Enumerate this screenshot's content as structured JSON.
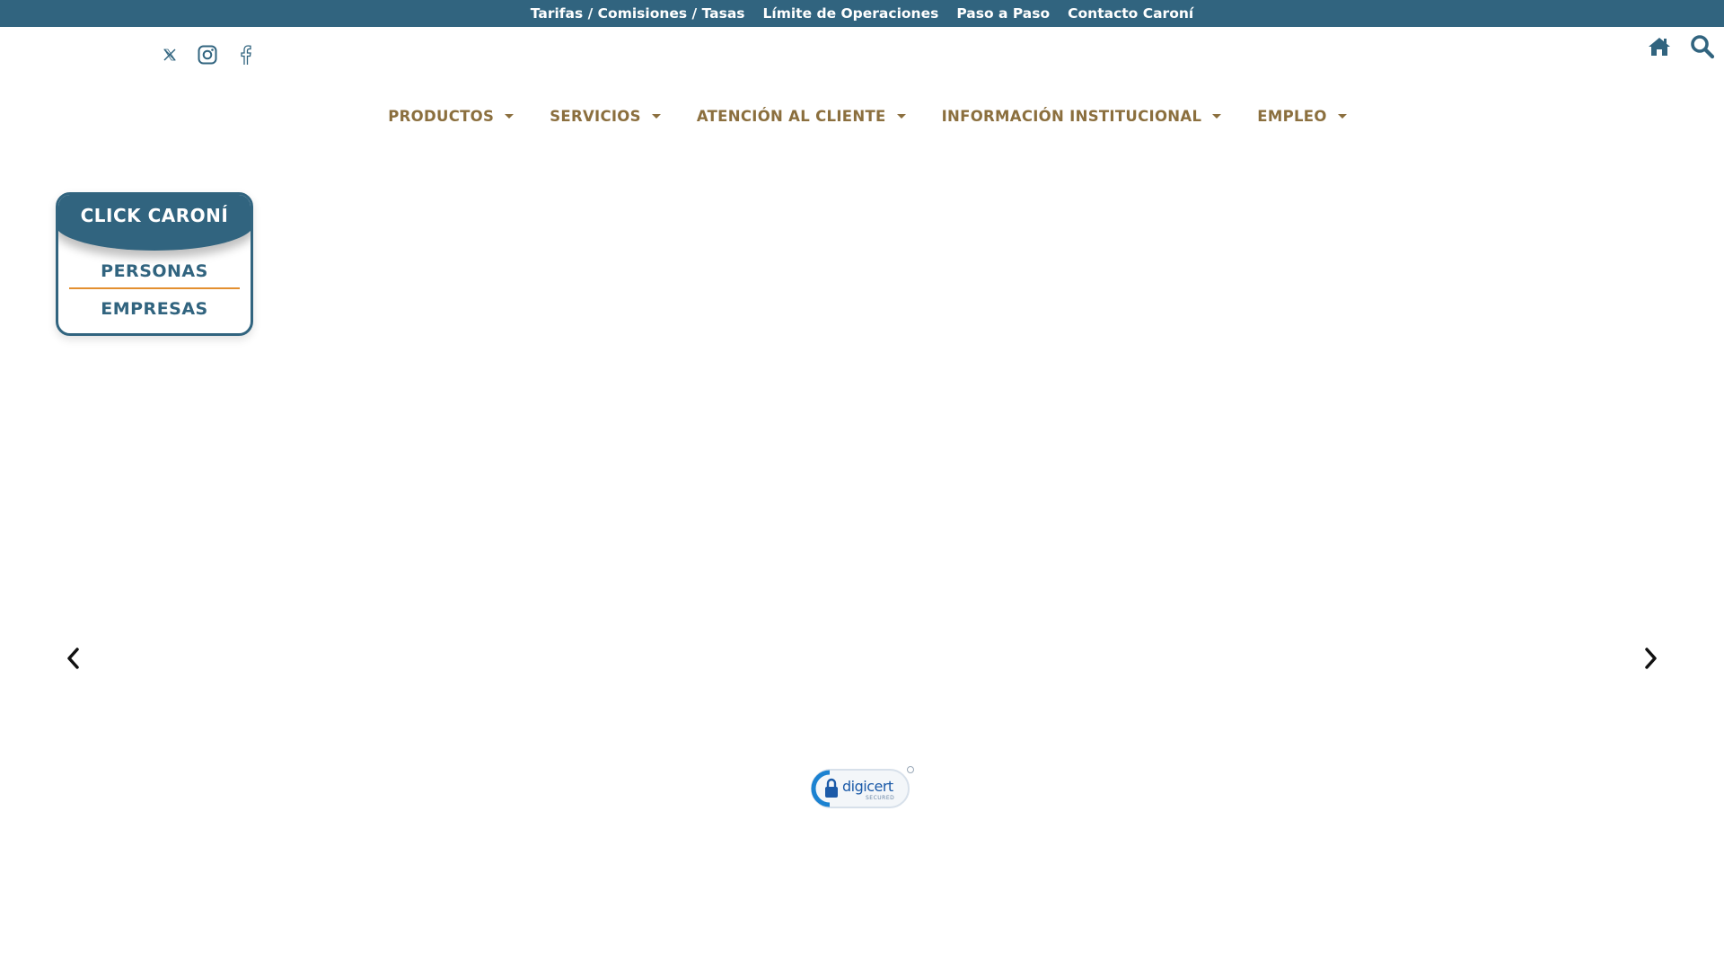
{
  "topbar": {
    "links": [
      "Tarifas / Comisiones / Tasas",
      "Límite de Operaciones",
      "Paso a Paso",
      "Contacto Caroní"
    ],
    "bg_color": "#31647f"
  },
  "social": {
    "icons": [
      "x-twitter-icon",
      "instagram-icon",
      "facebook-icon"
    ]
  },
  "header_icons": [
    "home-icon",
    "search-icon"
  ],
  "nav": {
    "items": [
      "PRODUCTOS",
      "SERVICIOS",
      "ATENCIÓN AL CLIENTE",
      "INFORMACIÓN INSTITUCIONAL",
      "EMPLEO"
    ],
    "color": "#8b6f3e"
  },
  "click_caroni": {
    "title": "CLICK CARONÍ",
    "links": [
      "PERSONAS",
      "EMPRESAS"
    ],
    "accent": "#e38f2f"
  },
  "carousel": {
    "prev_icon": "chevron-left-icon",
    "next_icon": "chevron-right-icon"
  },
  "seal": {
    "brand": "digicert",
    "sub": "SECURED"
  }
}
